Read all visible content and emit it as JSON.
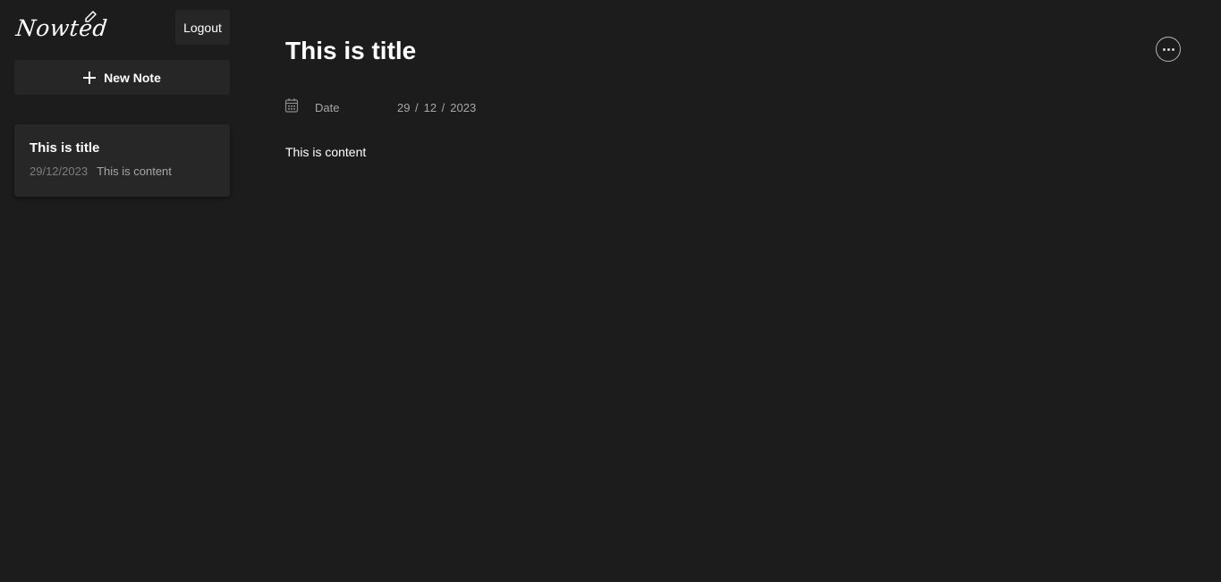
{
  "app": {
    "logo_text": "Nowted",
    "logout_label": "Logout",
    "new_note_label": "New Note"
  },
  "note_list": [
    {
      "title": "This is title",
      "date": "29/12/2023",
      "preview": "This is content"
    }
  ],
  "editor": {
    "title": "This is title",
    "date_label": "Date",
    "date_day": "29",
    "date_month": "12",
    "date_year": "2023",
    "content": "This is content"
  },
  "icons": {
    "logo_pen": "pen-icon",
    "new_note": "plus-icon",
    "date": "calendar-icon",
    "more": "more-options-icon"
  }
}
